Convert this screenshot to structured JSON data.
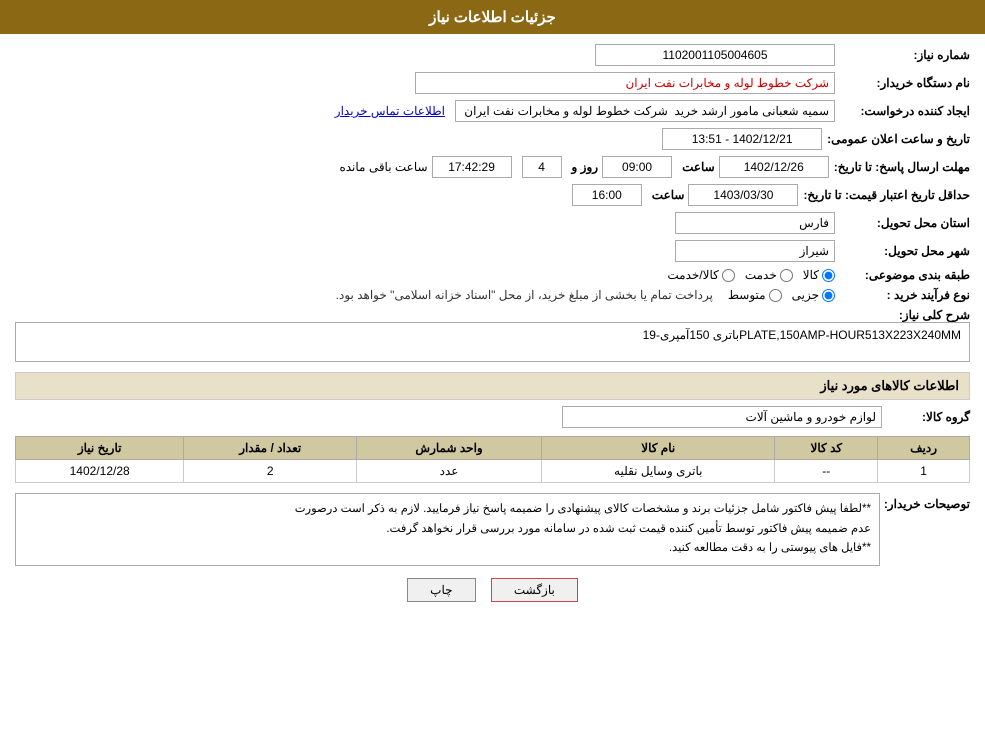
{
  "header": {
    "title": "جزئیات اطلاعات نیاز"
  },
  "fields": {
    "need_number_label": "شماره نیاز:",
    "need_number_value": "1102001105004605",
    "buyer_org_label": "نام دستگاه خریدار:",
    "buyer_org_value": "شرکت خطوط لوله و مخابرات نفت ایران",
    "creator_label": "ایجاد کننده درخواست:",
    "creator_value": "سمیه شعبانی مامور ارشد خرید  شرکت خطوط لوله و مخابرات نفت ایران",
    "contact_link": "اطلاعات تماس خریدار",
    "announce_date_label": "تاریخ و ساعت اعلان عمومی:",
    "announce_date_value": "1402/12/21 - 13:51",
    "reply_deadline_label": "مهلت ارسال پاسخ: تا تاریخ:",
    "reply_date_value": "1402/12/26",
    "reply_time_label": "ساعت",
    "reply_time_value": "09:00",
    "reply_days_label": "روز و",
    "reply_days_value": "4",
    "remaining_time_label": "ساعت باقی مانده",
    "remaining_time_value": "17:42:29",
    "price_validity_label": "حداقل تاریخ اعتبار قیمت: تا تاریخ:",
    "price_validity_date": "1403/03/30",
    "price_validity_time_label": "ساعت",
    "price_validity_time": "16:00",
    "province_label": "استان محل تحویل:",
    "province_value": "فارس",
    "city_label": "شهر محل تحویل:",
    "city_value": "شیراز",
    "category_label": "طبقه بندی موضوعی:",
    "category_goods": "کالا",
    "category_service": "خدمت",
    "category_goods_service": "کالا/خدمت",
    "process_label": "نوع فرآیند خرید :",
    "process_partial": "جزیی",
    "process_medium": "متوسط",
    "process_note": "پرداخت تمام یا بخشی از مبلغ خرید، از محل \"اسناد خزانه اسلامی\" خواهد بود.",
    "description_label": "شرح کلی نیاز:",
    "description_value": "باتری 150آمپری-19PLATE,150AMP-HOUR513X223X240MM"
  },
  "goods_section": {
    "title": "اطلاعات کالاهای مورد نیاز",
    "group_label": "گروه کالا:",
    "group_value": "لوازم خودرو و ماشین آلات",
    "table": {
      "columns": [
        "ردیف",
        "کد کالا",
        "نام کالا",
        "واحد شمارش",
        "تعداد / مقدار",
        "تاریخ نیاز"
      ],
      "rows": [
        {
          "row": "1",
          "code": "--",
          "name": "باتری وسایل نقلیه",
          "unit": "عدد",
          "quantity": "2",
          "date": "1402/12/28"
        }
      ]
    }
  },
  "buyer_notes": {
    "label": "توصیحات خریدار:",
    "line1": "**لطفا پیش فاکتور شامل جزئیات برند و مشخصات کالای پیشنهادی را ضمیمه پاسخ نیاز فرمایید. لازم به ذکر است درصورت",
    "line2": "عدم ضمیمه پیش فاکتور توسط تأمین کننده قیمت ثبت شده در سامانه مورد بررسی قرار نخواهد گرفت.",
    "line3": "**فایل های پیوستی را به دقت مطالعه کنید."
  },
  "buttons": {
    "print": "چاپ",
    "back": "بازگشت"
  }
}
